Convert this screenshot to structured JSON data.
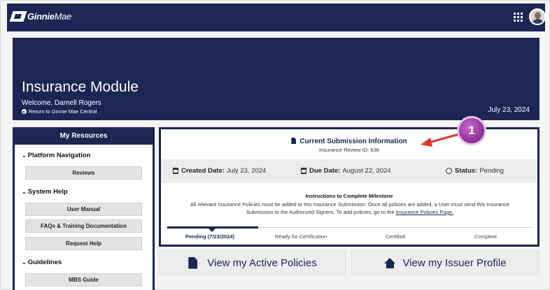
{
  "app": {
    "logo_bold": "Ginnie",
    "logo_rest": "Mae"
  },
  "hero": {
    "title": "Insurance Module",
    "welcome": "Welcome, Darnell Rogers",
    "return_link": "Return to Ginnie Mae Central",
    "date": "July 23, 2024"
  },
  "sidebar": {
    "header": "My Resources",
    "sections": [
      {
        "title": "Platform Navigation",
        "items": [
          "Reviews"
        ]
      },
      {
        "title": "System Help",
        "items": [
          "User Manual",
          "FAQs & Training Documentation",
          "Request Help"
        ]
      },
      {
        "title": "Guidelines",
        "items": [
          "MBS Guide"
        ]
      }
    ]
  },
  "card": {
    "title": "Current Submission Information",
    "subtitle": "Insurance Review ID: 636",
    "created_label": "Created Date:",
    "created_value": "July 23, 2024",
    "due_label": "Due Date:",
    "due_value": "August 22, 2024",
    "status_label": "Status:",
    "status_value": "Pending",
    "instructions_title": "Instructions to Complete Milestone",
    "instructions_text": "All relevant Insurance Policies must be added to this Insurance Submission. Once all policies are added, a User must send this Insurance Submission to the Authorized Signers. To add policies, go to the ",
    "instructions_link": "Insurance Policies Page.",
    "steps": [
      "Pending (7/23/2024)",
      "Ready for Certification",
      "Certified",
      "Complete"
    ]
  },
  "buttons": {
    "active_policies": "View my Active Policies",
    "issuer_profile": "View my Issuer Profile"
  },
  "annotation": {
    "badge": "1"
  },
  "colors": {
    "navy": "#1b2653",
    "callout_purple": "#8b2f93",
    "arrow_red": "#e0362b"
  }
}
